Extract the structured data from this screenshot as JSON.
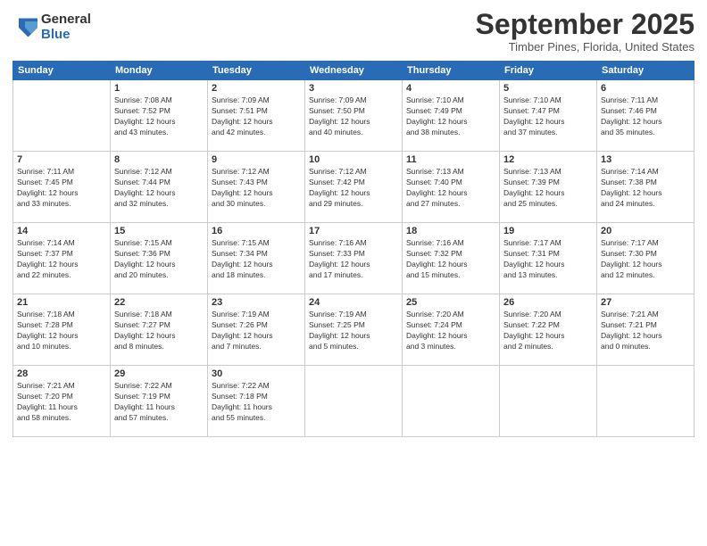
{
  "logo": {
    "general": "General",
    "blue": "Blue"
  },
  "title": "September 2025",
  "subtitle": "Timber Pines, Florida, United States",
  "days_of_week": [
    "Sunday",
    "Monday",
    "Tuesday",
    "Wednesday",
    "Thursday",
    "Friday",
    "Saturday"
  ],
  "weeks": [
    [
      {
        "num": "",
        "info": ""
      },
      {
        "num": "1",
        "info": "Sunrise: 7:08 AM\nSunset: 7:52 PM\nDaylight: 12 hours\nand 43 minutes."
      },
      {
        "num": "2",
        "info": "Sunrise: 7:09 AM\nSunset: 7:51 PM\nDaylight: 12 hours\nand 42 minutes."
      },
      {
        "num": "3",
        "info": "Sunrise: 7:09 AM\nSunset: 7:50 PM\nDaylight: 12 hours\nand 40 minutes."
      },
      {
        "num": "4",
        "info": "Sunrise: 7:10 AM\nSunset: 7:49 PM\nDaylight: 12 hours\nand 38 minutes."
      },
      {
        "num": "5",
        "info": "Sunrise: 7:10 AM\nSunset: 7:47 PM\nDaylight: 12 hours\nand 37 minutes."
      },
      {
        "num": "6",
        "info": "Sunrise: 7:11 AM\nSunset: 7:46 PM\nDaylight: 12 hours\nand 35 minutes."
      }
    ],
    [
      {
        "num": "7",
        "info": "Sunrise: 7:11 AM\nSunset: 7:45 PM\nDaylight: 12 hours\nand 33 minutes."
      },
      {
        "num": "8",
        "info": "Sunrise: 7:12 AM\nSunset: 7:44 PM\nDaylight: 12 hours\nand 32 minutes."
      },
      {
        "num": "9",
        "info": "Sunrise: 7:12 AM\nSunset: 7:43 PM\nDaylight: 12 hours\nand 30 minutes."
      },
      {
        "num": "10",
        "info": "Sunrise: 7:12 AM\nSunset: 7:42 PM\nDaylight: 12 hours\nand 29 minutes."
      },
      {
        "num": "11",
        "info": "Sunrise: 7:13 AM\nSunset: 7:40 PM\nDaylight: 12 hours\nand 27 minutes."
      },
      {
        "num": "12",
        "info": "Sunrise: 7:13 AM\nSunset: 7:39 PM\nDaylight: 12 hours\nand 25 minutes."
      },
      {
        "num": "13",
        "info": "Sunrise: 7:14 AM\nSunset: 7:38 PM\nDaylight: 12 hours\nand 24 minutes."
      }
    ],
    [
      {
        "num": "14",
        "info": "Sunrise: 7:14 AM\nSunset: 7:37 PM\nDaylight: 12 hours\nand 22 minutes."
      },
      {
        "num": "15",
        "info": "Sunrise: 7:15 AM\nSunset: 7:36 PM\nDaylight: 12 hours\nand 20 minutes."
      },
      {
        "num": "16",
        "info": "Sunrise: 7:15 AM\nSunset: 7:34 PM\nDaylight: 12 hours\nand 18 minutes."
      },
      {
        "num": "17",
        "info": "Sunrise: 7:16 AM\nSunset: 7:33 PM\nDaylight: 12 hours\nand 17 minutes."
      },
      {
        "num": "18",
        "info": "Sunrise: 7:16 AM\nSunset: 7:32 PM\nDaylight: 12 hours\nand 15 minutes."
      },
      {
        "num": "19",
        "info": "Sunrise: 7:17 AM\nSunset: 7:31 PM\nDaylight: 12 hours\nand 13 minutes."
      },
      {
        "num": "20",
        "info": "Sunrise: 7:17 AM\nSunset: 7:30 PM\nDaylight: 12 hours\nand 12 minutes."
      }
    ],
    [
      {
        "num": "21",
        "info": "Sunrise: 7:18 AM\nSunset: 7:28 PM\nDaylight: 12 hours\nand 10 minutes."
      },
      {
        "num": "22",
        "info": "Sunrise: 7:18 AM\nSunset: 7:27 PM\nDaylight: 12 hours\nand 8 minutes."
      },
      {
        "num": "23",
        "info": "Sunrise: 7:19 AM\nSunset: 7:26 PM\nDaylight: 12 hours\nand 7 minutes."
      },
      {
        "num": "24",
        "info": "Sunrise: 7:19 AM\nSunset: 7:25 PM\nDaylight: 12 hours\nand 5 minutes."
      },
      {
        "num": "25",
        "info": "Sunrise: 7:20 AM\nSunset: 7:24 PM\nDaylight: 12 hours\nand 3 minutes."
      },
      {
        "num": "26",
        "info": "Sunrise: 7:20 AM\nSunset: 7:22 PM\nDaylight: 12 hours\nand 2 minutes."
      },
      {
        "num": "27",
        "info": "Sunrise: 7:21 AM\nSunset: 7:21 PM\nDaylight: 12 hours\nand 0 minutes."
      }
    ],
    [
      {
        "num": "28",
        "info": "Sunrise: 7:21 AM\nSunset: 7:20 PM\nDaylight: 11 hours\nand 58 minutes."
      },
      {
        "num": "29",
        "info": "Sunrise: 7:22 AM\nSunset: 7:19 PM\nDaylight: 11 hours\nand 57 minutes."
      },
      {
        "num": "30",
        "info": "Sunrise: 7:22 AM\nSunset: 7:18 PM\nDaylight: 11 hours\nand 55 minutes."
      },
      {
        "num": "",
        "info": ""
      },
      {
        "num": "",
        "info": ""
      },
      {
        "num": "",
        "info": ""
      },
      {
        "num": "",
        "info": ""
      }
    ]
  ]
}
